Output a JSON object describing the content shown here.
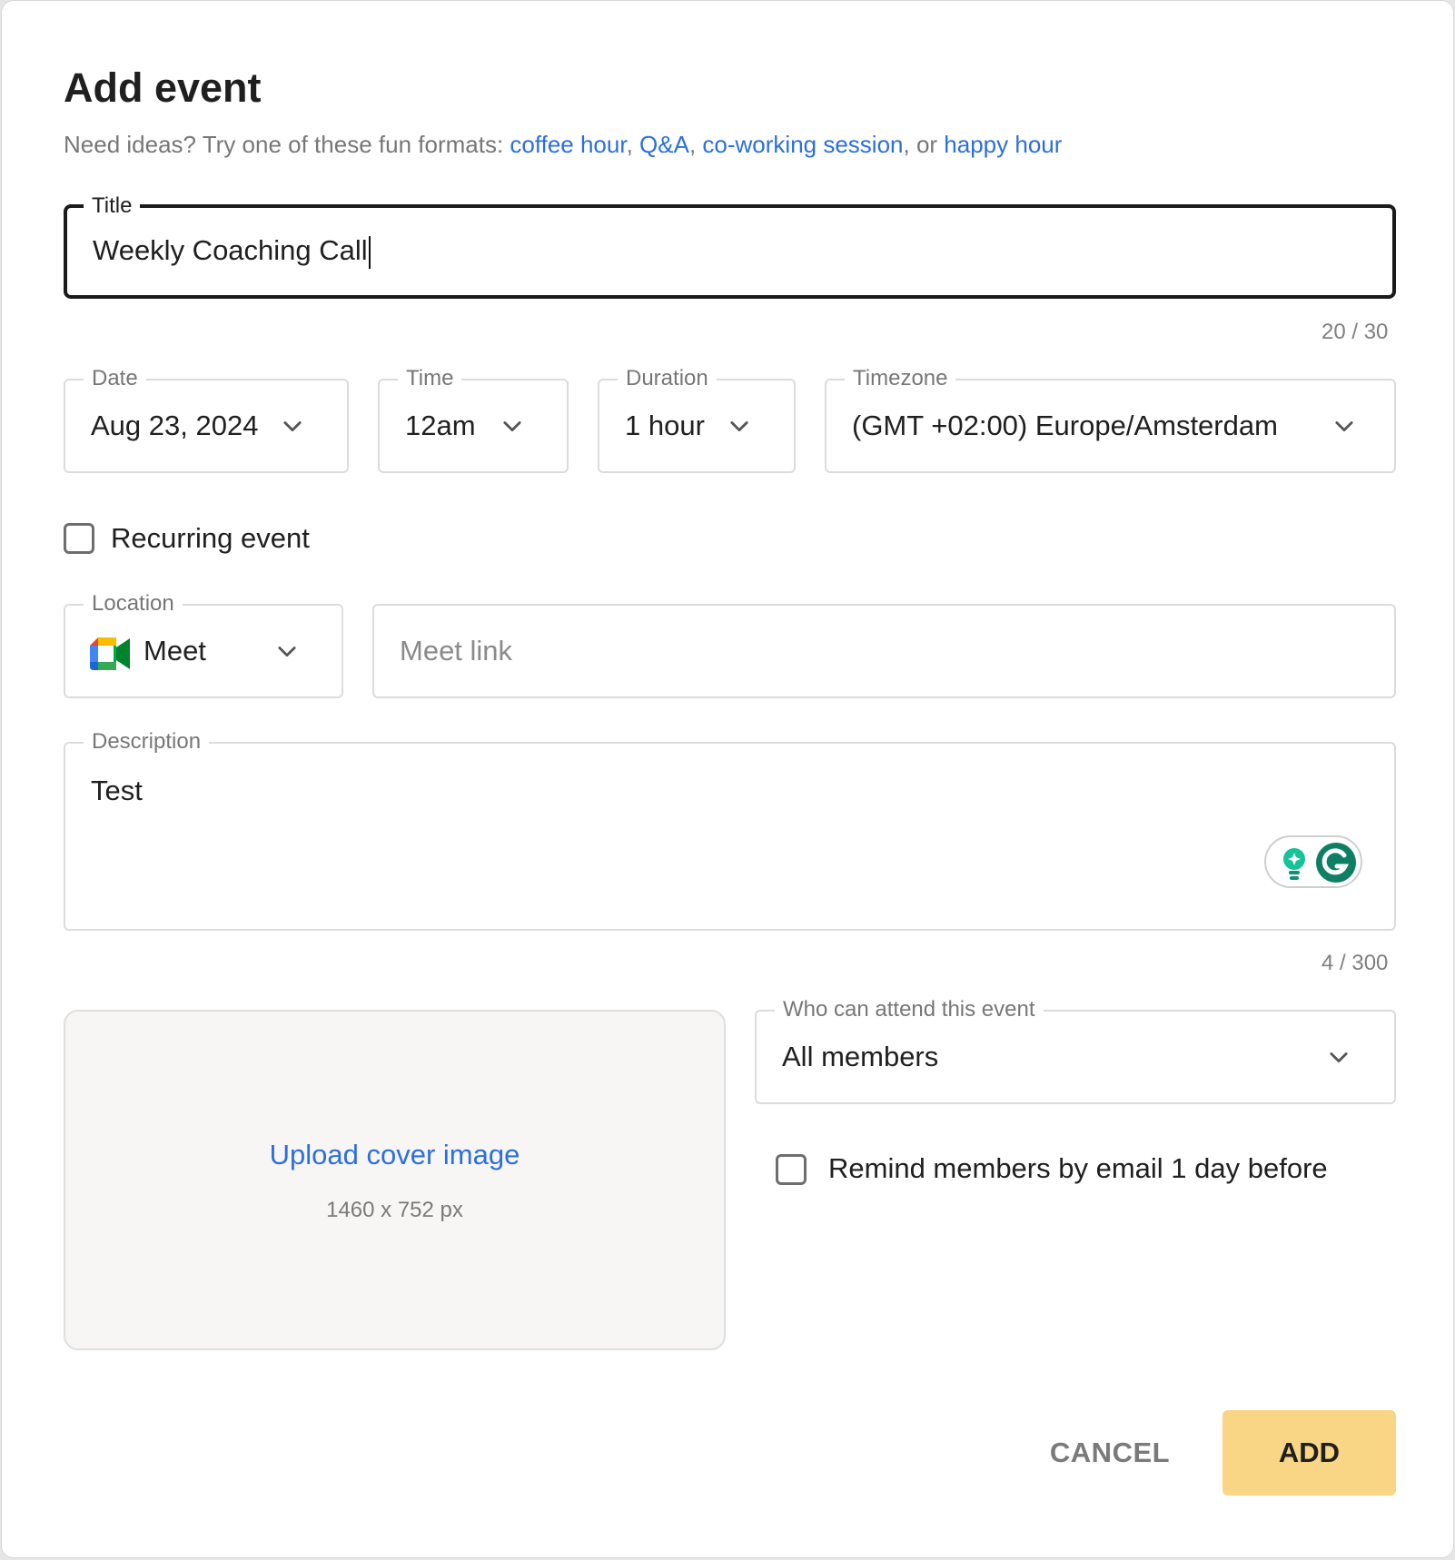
{
  "dialog": {
    "title": "Add event",
    "ideas": {
      "prefix": "Need ideas? Try one of these fun formats: ",
      "link1": "coffee hour",
      "sep1": ", ",
      "link2": "Q&A",
      "sep2": ", ",
      "link3": "co-working session",
      "sep3": ", or ",
      "link4": "happy hour"
    }
  },
  "title_field": {
    "label": "Title",
    "value": "Weekly Coaching Call",
    "counter": "20 / 30"
  },
  "date_field": {
    "label": "Date",
    "value": "Aug 23, 2024"
  },
  "time_field": {
    "label": "Time",
    "value": "12am"
  },
  "duration_field": {
    "label": "Duration",
    "value": "1 hour"
  },
  "timezone_field": {
    "label": "Timezone",
    "value": "(GMT +02:00) Europe/Amsterdam"
  },
  "recurring": {
    "label": "Recurring event",
    "checked": false
  },
  "location_field": {
    "label": "Location",
    "value": "Meet",
    "icon": "google-meet-icon"
  },
  "meet_link": {
    "placeholder": "Meet link",
    "value": ""
  },
  "description_field": {
    "label": "Description",
    "value": "Test",
    "counter": "4 / 300"
  },
  "cover": {
    "link": "Upload cover image",
    "size": "1460 x 752 px"
  },
  "attend_field": {
    "label": "Who can attend this event",
    "value": "All members"
  },
  "remind": {
    "label": "Remind members by email 1 day before",
    "checked": false
  },
  "actions": {
    "cancel": "CANCEL",
    "add": "ADD"
  },
  "colors": {
    "link": "#2b6fdf",
    "add_button": "#f8d685",
    "focus_border": "#1b1b1b"
  }
}
